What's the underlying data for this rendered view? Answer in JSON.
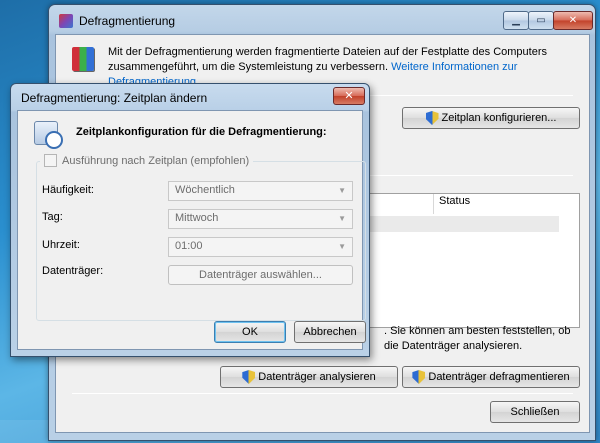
{
  "main_window": {
    "title": "Defragmentierung",
    "intro_text": "Mit der Defragmentierung werden fragmentierte Dateien auf der Festplatte des Computers zusammengeführt, um die Systemleistung zu verbessern.",
    "intro_link": "Weitere Informationen zur Defragmentierung",
    "configure_schedule_button": "Zeitplan konfigurieren...",
    "disk_list": {
      "columns": [
        "Status"
      ]
    },
    "analyze_hint": ". Sie können am besten feststellen, ob die Datenträger analysieren.",
    "analyze_button": "Datenträger analysieren",
    "defrag_button": "Datenträger defragmentieren",
    "close_button": "Schließen"
  },
  "dialog": {
    "title": "Defragmentierung: Zeitplan ändern",
    "heading": "Zeitplankonfiguration für die Defragmentierung:",
    "schedule_checkbox_label": "Ausführung nach Zeitplan (empfohlen)",
    "schedule_checked": false,
    "frequency_label": "Häufigkeit:",
    "frequency_value": "Wöchentlich",
    "day_label": "Tag:",
    "day_value": "Mittwoch",
    "time_label": "Uhrzeit:",
    "time_value": "01:00",
    "disks_label": "Datenträger:",
    "select_disks_button": "Datenträger auswählen...",
    "ok_button": "OK",
    "cancel_button": "Abbrechen"
  },
  "colors": {
    "link": "#0066cc",
    "titlebar": "#b6cde4",
    "close_button": "#c2412a"
  }
}
